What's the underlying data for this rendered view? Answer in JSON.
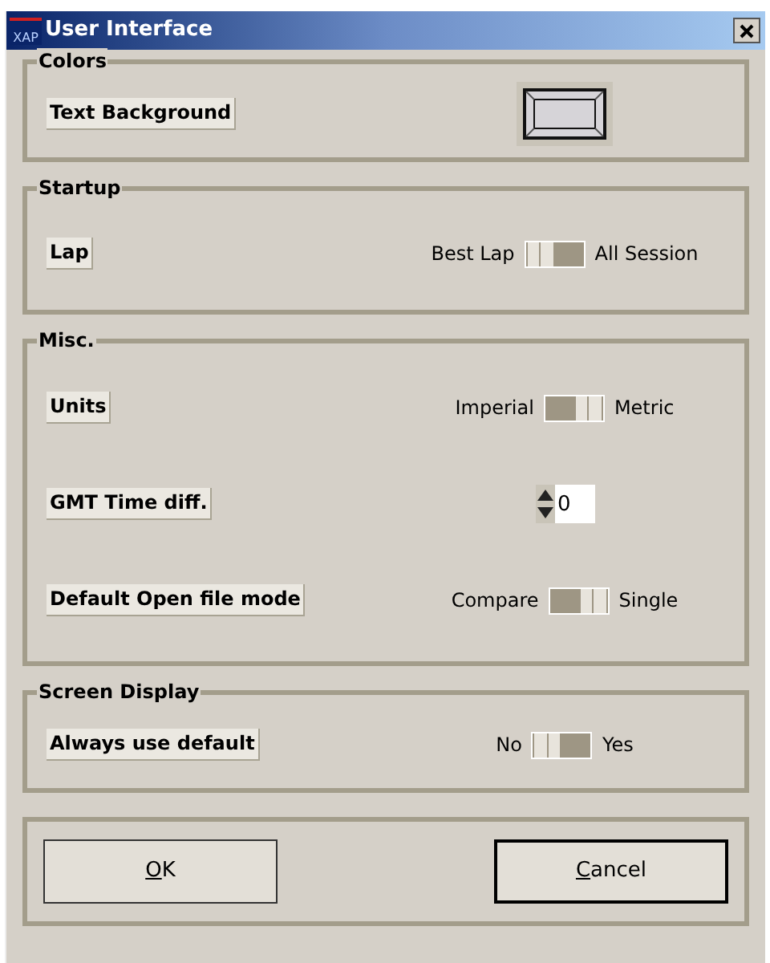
{
  "window": {
    "title": "User Interface",
    "app_icon_text": "XAP"
  },
  "groups": [
    {
      "title": "Colors",
      "rows": [
        {
          "kind": "color",
          "label": "Text Background"
        }
      ]
    },
    {
      "title": "Startup",
      "rows": [
        {
          "kind": "toggle",
          "label": "Lap",
          "left": "Best Lap",
          "right": "All Session",
          "on": false
        }
      ]
    },
    {
      "title": "Misc.",
      "rows": [
        {
          "kind": "toggle",
          "label": "Units",
          "left": "Imperial",
          "right": "Metric",
          "on": true
        },
        {
          "kind": "spinner",
          "label": "GMT Time diff.",
          "value": "0"
        },
        {
          "kind": "toggle",
          "label": "Default Open file mode",
          "left": "Compare",
          "right": "Single",
          "on": true
        }
      ]
    },
    {
      "title": "Screen Display",
      "rows": [
        {
          "kind": "toggle",
          "label": "Always use default",
          "left": "No",
          "right": "Yes",
          "on": false
        }
      ]
    }
  ],
  "buttons": [
    {
      "label": "OK",
      "mnemonic_underlined": true,
      "default": false
    },
    {
      "label": "Cancel",
      "mnemonic_underlined": true,
      "default": true
    }
  ]
}
